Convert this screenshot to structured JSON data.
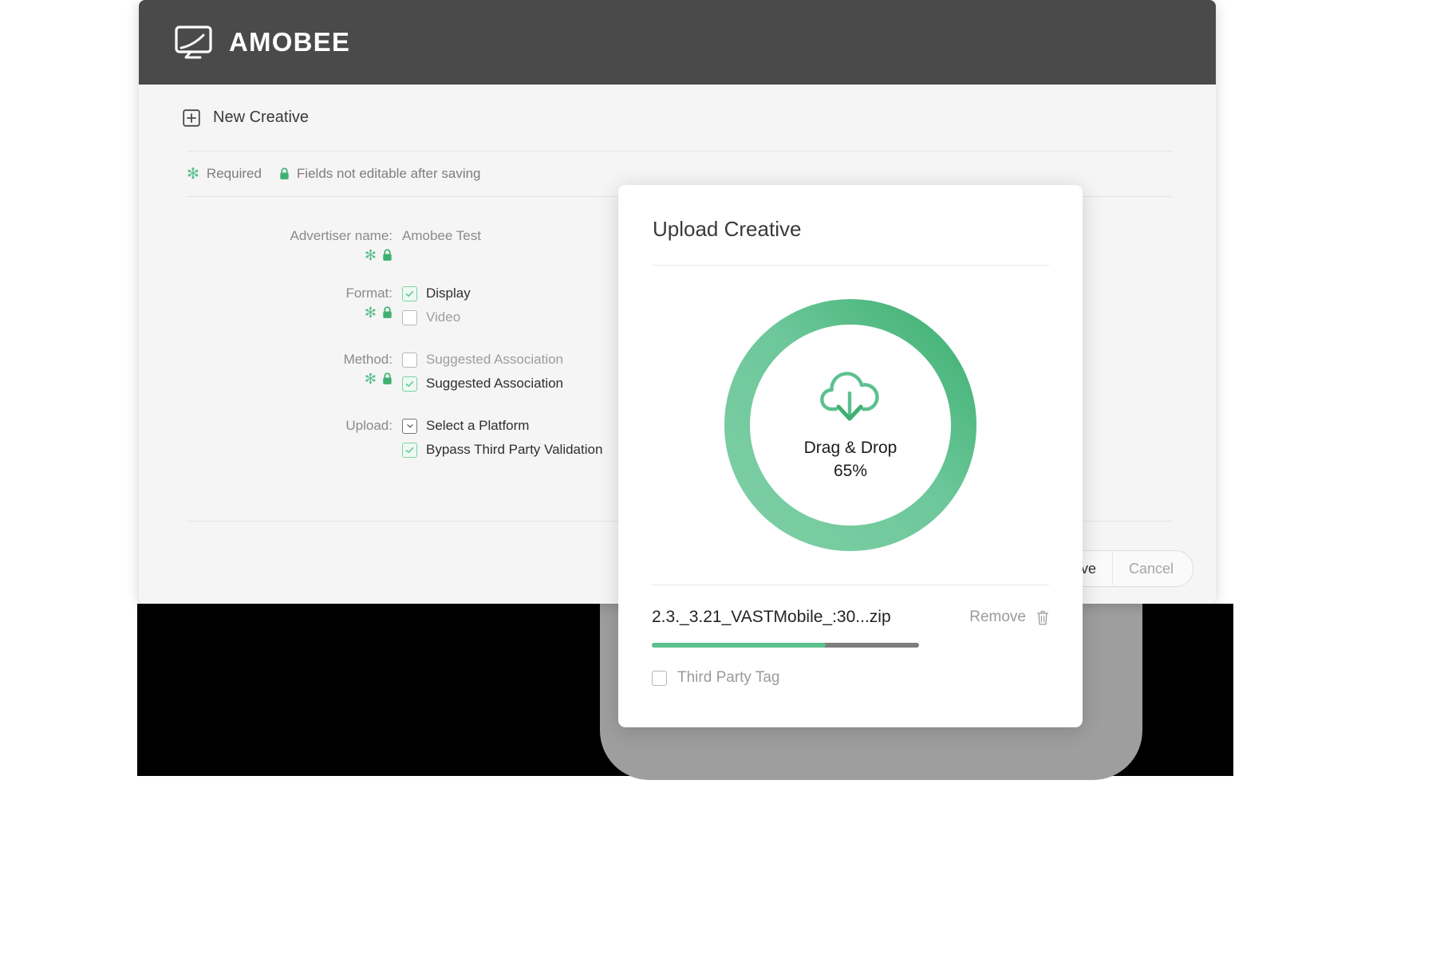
{
  "app": {
    "brand_name": "AMOBEE",
    "brand_icon": "monitor-swoosh-icon",
    "header_bg": "#4a4a4a"
  },
  "page": {
    "add_icon": "plus-square-icon",
    "title": "New Creative"
  },
  "legend": {
    "required_mark": "✻",
    "required_label": "Required",
    "lock_icon": "lock-icon",
    "lock_label": "Fields not editable after saving"
  },
  "form": {
    "rows": [
      {
        "label": "Advertiser name:",
        "value": "Amobee Test",
        "marks": "required-and-lock"
      },
      {
        "label": "Format:",
        "options": [
          {
            "text": "Display",
            "state": "checked",
            "muted": false
          },
          {
            "text": "Video",
            "state": "unchecked",
            "muted": true
          }
        ],
        "marks": "required-and-lock"
      },
      {
        "label": "Method:",
        "options": [
          {
            "text": "Suggested Association",
            "state": "unchecked",
            "muted": true
          },
          {
            "text": "Suggested Association",
            "state": "checked",
            "muted": false
          }
        ],
        "marks": "required-and-lock"
      },
      {
        "label": "Upload:",
        "options": [
          {
            "text": "Select a Platform",
            "state": "dropdown",
            "muted": false
          },
          {
            "text": "Bypass Third Party Validation",
            "state": "checked",
            "muted": false
          }
        ],
        "marks": "none"
      }
    ]
  },
  "actions": {
    "save_label": "Save",
    "cancel_label": "Cancel"
  },
  "modal": {
    "title": "Upload Creative",
    "dropzone": {
      "icon": "cloud-download-icon",
      "primary_text": "Drag & Drop",
      "percent_text": "65%",
      "percent_value": 65,
      "ring_color_start": "#7ecfa4",
      "ring_color_end": "#3fb071"
    },
    "file": {
      "name": "2.3._3.21_VASTMobile_:30...zip",
      "remove_label": "Remove",
      "trash_icon": "trash-icon",
      "progress_percent": 65,
      "progress_fill_color": "#5cc08f",
      "progress_track_color": "#7d7d7d"
    },
    "third_party_tag": {
      "label": "Third Party Tag",
      "state": "unchecked"
    }
  }
}
